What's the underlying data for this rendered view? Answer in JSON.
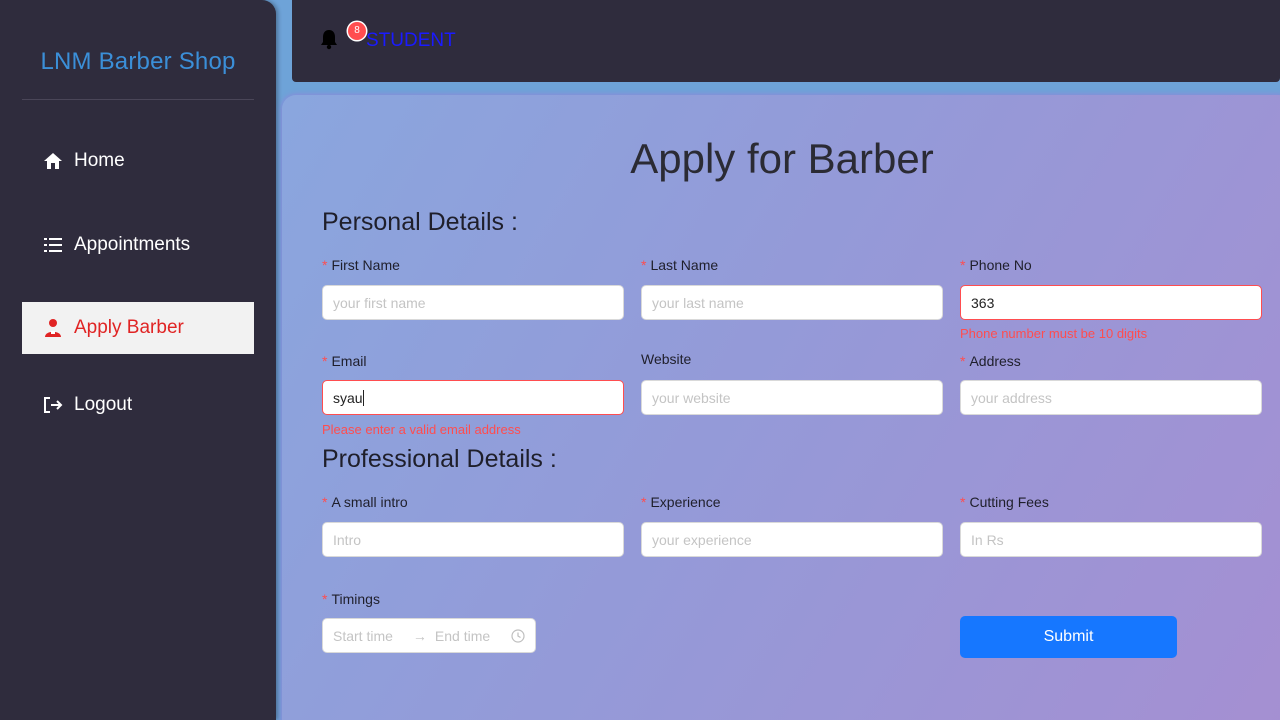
{
  "sidebar": {
    "brand": "LNM Barber Shop",
    "items": [
      {
        "label": "Home",
        "icon": "home-icon"
      },
      {
        "label": "Appointments",
        "icon": "list-icon"
      },
      {
        "label": "Apply Barber",
        "icon": "user-icon",
        "active": true
      },
      {
        "label": "Logout",
        "icon": "logout-icon"
      }
    ]
  },
  "topbar": {
    "notification_count": "8",
    "role": "STUDENT",
    "icon": "bell-icon"
  },
  "form": {
    "title": "Apply for Barber",
    "personal_title": "Personal Details :",
    "professional_title": "Professional Details :",
    "fields": {
      "first_name": {
        "label": "First Name",
        "placeholder": "your first name",
        "value": ""
      },
      "last_name": {
        "label": "Last Name",
        "placeholder": "your last name",
        "value": ""
      },
      "phone": {
        "label": "Phone No",
        "placeholder": "",
        "value": "363",
        "error": "Phone number must be 10 digits"
      },
      "email": {
        "label": "Email",
        "placeholder": "",
        "value": "syau",
        "error": "Please enter a valid email address"
      },
      "website": {
        "label": "Website",
        "placeholder": "your website",
        "value": ""
      },
      "address": {
        "label": "Address",
        "placeholder": "your address",
        "value": ""
      },
      "intro": {
        "label": "A small intro",
        "placeholder": "Intro",
        "value": ""
      },
      "experience": {
        "label": "Experience",
        "placeholder": "your experience",
        "value": ""
      },
      "fees": {
        "label": "Cutting Fees",
        "placeholder": "In Rs",
        "value": ""
      },
      "timings": {
        "label": "Timings",
        "start_placeholder": "Start time",
        "end_placeholder": "End time",
        "arrow": "→"
      }
    },
    "required_mark": "*",
    "submit_label": "Submit"
  },
  "colors": {
    "accent": "#1677ff",
    "error": "#ff4d4f",
    "sidebar_bg": "#2f2c3d",
    "brand": "#3b8fd8"
  }
}
